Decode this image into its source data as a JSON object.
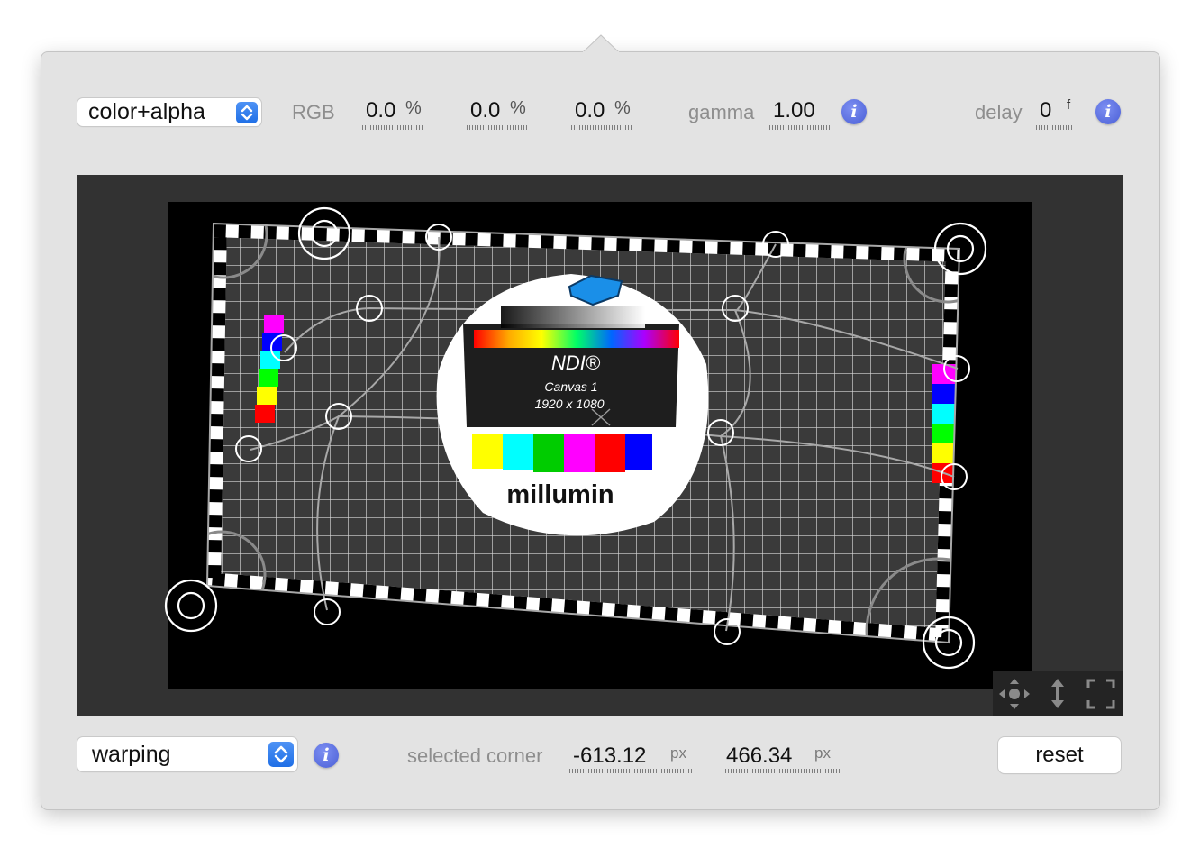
{
  "top_bar": {
    "mode_select": "color+alpha",
    "rgb_label": "RGB",
    "r_value": "0.0",
    "g_value": "0.0",
    "b_value": "0.0",
    "percent_unit": "%",
    "gamma_label": "gamma",
    "gamma_value": "1.00",
    "delay_label": "delay",
    "delay_value": "0",
    "delay_unit": "f"
  },
  "preview": {
    "card_title": "NDI®",
    "card_subtitle": "Canvas 1",
    "card_resolution": "1920 x 1080",
    "card_brand": "millumin",
    "tools": [
      "move-icon",
      "vertical-arrow-icon",
      "fullscreen-icon"
    ]
  },
  "bottom_bar": {
    "mapping_select": "warping",
    "selected_corner_label": "selected corner",
    "x_value": "-613.12",
    "y_value": "466.34",
    "px_unit": "px",
    "reset_label": "reset"
  },
  "colors": {
    "accent": "#2a78ee",
    "info": "#5a6ee0",
    "panel": "#e3e3e3",
    "preview_bg": "#323232"
  }
}
